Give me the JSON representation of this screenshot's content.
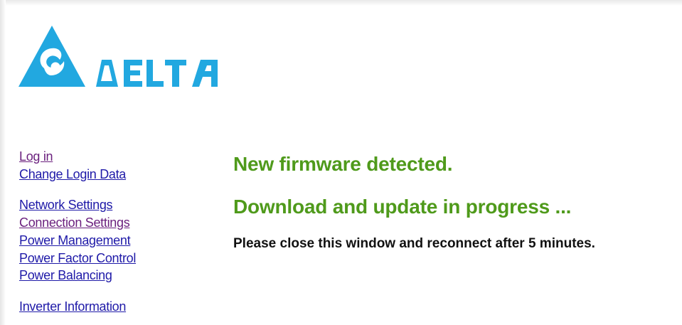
{
  "brand": {
    "logo_text": "DELTA",
    "logo_color": "#22a8e0"
  },
  "nav": {
    "link_color": "#1f1aa8",
    "visited_color": "#6a1f7d",
    "groups": [
      {
        "items": [
          {
            "label": "Log in"
          },
          {
            "label": "Change Login Data"
          }
        ]
      },
      {
        "items": [
          {
            "label": "Network Settings"
          },
          {
            "label": "Connection Settings"
          },
          {
            "label": "Power Management"
          },
          {
            "label": "Power Factor Control"
          },
          {
            "label": "Power Balancing"
          }
        ]
      },
      {
        "items": [
          {
            "label": "Inverter Information"
          }
        ]
      }
    ]
  },
  "main": {
    "headline_color": "#4f9a1b",
    "firmware_detected": "New firmware detected.",
    "update_progress": "Download and update in progress ...",
    "notice": "Please close this window and reconnect after 5 minutes."
  }
}
